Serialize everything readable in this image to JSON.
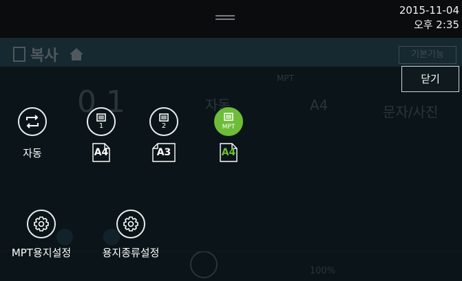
{
  "status": {
    "date": "2015-11-04",
    "time": "오후 2:35"
  },
  "app": {
    "title": "복사",
    "basic_button": "기본기능",
    "ghost": {
      "counter": "0 1",
      "mode": "자동",
      "tray": "MPT",
      "size": "A4",
      "text": "문자/사진",
      "zoom": "100%"
    }
  },
  "overlay": {
    "close_label": "닫기",
    "options": [
      {
        "label": "자동",
        "icon": "auto-rotate-icon",
        "paper": "A4"
      },
      {
        "tray": "1",
        "icon": "tray-1-icon",
        "paper": "A4"
      },
      {
        "tray": "2",
        "icon": "tray-2-icon",
        "paper": "A3"
      },
      {
        "tray": "MPT",
        "icon": "mpt-tray-icon",
        "paper": "A4",
        "selected": true
      }
    ],
    "settings": [
      {
        "label": "MPT용지설정",
        "icon": "gear-icon"
      },
      {
        "label": "용지종류설정",
        "icon": "gear-icon"
      }
    ]
  },
  "colors": {
    "accent": "#6dbd38",
    "background": "#0b1519",
    "status_bar": "#0a0c0e"
  }
}
